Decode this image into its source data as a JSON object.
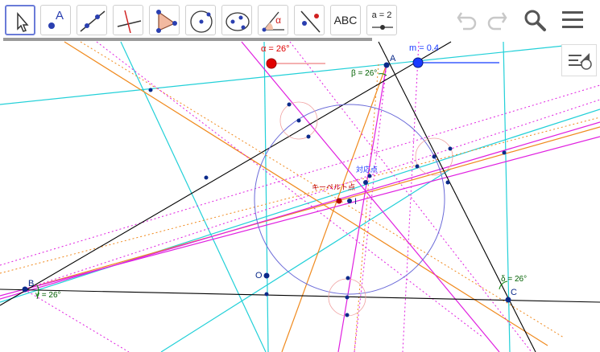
{
  "toolbar": {
    "tools": [
      {
        "name": "move-tool"
      },
      {
        "name": "point-tool",
        "text": "A"
      },
      {
        "name": "line-tool"
      },
      {
        "name": "perpendicular-line-tool"
      },
      {
        "name": "polygon-tool"
      },
      {
        "name": "circle-center-point-tool"
      },
      {
        "name": "conic-tool"
      },
      {
        "name": "angle-tool",
        "text": "α"
      },
      {
        "name": "reflect-tool"
      },
      {
        "name": "text-tool",
        "text": "ABC"
      },
      {
        "name": "slider-tool",
        "text": "a = 2"
      }
    ],
    "undo_icon": "undo-icon",
    "redo_icon": "redo-icon",
    "search_icon": "search-icon",
    "menu_icon": "menu-icon"
  },
  "sliders": {
    "alpha": {
      "label": "α = 26°",
      "value": 26,
      "min": 0,
      "max": 90,
      "color": "#e00000"
    },
    "m": {
      "label": "m = 0.4",
      "value": 0.4,
      "min": 0,
      "max": 1,
      "color": "#1a3bff"
    }
  },
  "labels": {
    "A": "A",
    "B": "B",
    "C": "C",
    "O": "O",
    "I": "I",
    "beta": "β = 26°",
    "gamma": "γ = 26°",
    "delta": "δ = 26°",
    "kiepert": "キーペルト点",
    "lemoine": "対応点"
  },
  "colors": {
    "triangle": "#000000",
    "cyan": "#22d0d8",
    "orange": "#f08a1e",
    "magenta": "#e020e0",
    "circle": "#6a6ad8",
    "points": "#0b2a8a",
    "kiepert": "#b00000"
  }
}
